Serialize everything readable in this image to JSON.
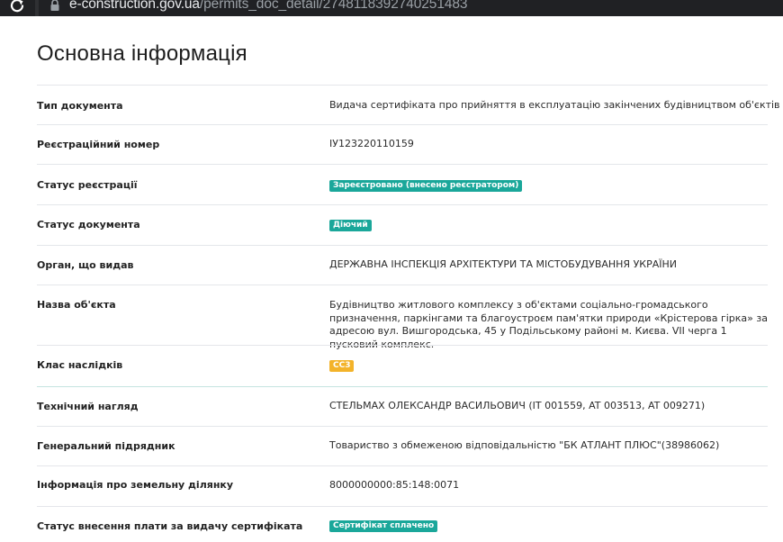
{
  "browser": {
    "url_host": "e-construction.gov.ua",
    "url_path": "/permits_doc_detail/2748118392740251483"
  },
  "page_title": "Основна інформація",
  "rows": [
    {
      "label": "Тип документа",
      "value": "Видача сертифіката про прийняття в експлуатацію закінчених будівництвом об'єктів"
    },
    {
      "label": "Реєстраційний номер",
      "value": "IУ123220110159"
    },
    {
      "label": "Статус реєстрації",
      "badge": "Зареєстровано (внесено реєстратором)",
      "badge_color": "#1aa79a"
    },
    {
      "label": "Статус документа",
      "badge": "Діючий",
      "badge_color": "#1aa79a"
    },
    {
      "label": "Орган, що видав",
      "value": "ДЕРЖАВНА ІНСПЕКЦІЯ АРХІТЕКТУРИ ТА МІСТОБУДУВАННЯ УКРАЇНИ"
    },
    {
      "label": "Назва об'єкта",
      "value": "Будівництво житлового комплексу з об'єктами соціально-громадського призначення, паркінгами та благоустроєм пам'ятки природи «Крістерова гірка» за адресою вул. Вишгородська, 45 у Подільському районі м. Києва. VII черга 1 пусковий комплекс."
    },
    {
      "label": "Клас наслідків",
      "badge": "СС3",
      "badge_color": "#f3b32a"
    },
    {
      "label": "Технічний нагляд",
      "value": "СТЕЛЬМАХ ОЛЕКСАНДР ВАСИЛЬОВИЧ (IT 001559, AT 003513, AT 009271)"
    },
    {
      "label": "Генеральний підрядник",
      "value": "Товариство з обмеженою відповідальністю \"БК АТЛАНТ ПЛЮС\"(38986062)"
    },
    {
      "label": "Інформація про земельну ділянку",
      "value": "8000000000:85:148:0071"
    },
    {
      "label": "Статус внесення плати за видачу сертифіката",
      "badge": "Сертифікат сплачено",
      "badge_color": "#1aa79a"
    }
  ]
}
